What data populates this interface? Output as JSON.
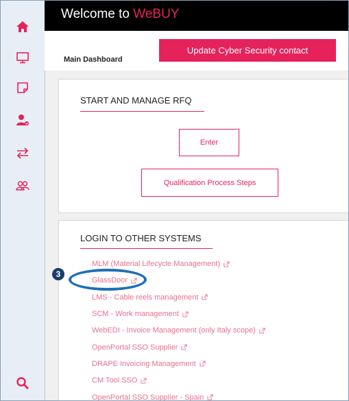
{
  "header": {
    "title_prefix": "Welcome to ",
    "title_brand": "WeBUY"
  },
  "dashboard": {
    "label": "Main Dashboard",
    "update_button": "Update Cyber Security contact"
  },
  "rfq_card": {
    "title": "START AND MANAGE RFQ",
    "enter_button": "Enter",
    "qualification_button": "Qualification Process Steps"
  },
  "login_card": {
    "title": "LOGIN TO OTHER SYSTEMS",
    "links": [
      "MLM (Material Lifecycle Management)",
      "GlassDoor",
      "LMS - Cable reels management",
      "SCM - Work management",
      "WebEDI - Invoice Management (only Italy scope)",
      "OpenPortal SSO Supplier",
      "DRAPE Invoicing Management",
      "CM Tool SSO",
      "OpenPortal SSO Supplier - Spain"
    ]
  },
  "annotation": {
    "step_number": "3"
  },
  "sidebar": {
    "icons": [
      "home-icon",
      "monitor-icon",
      "note-icon",
      "user-check-icon",
      "swap-arrows-icon",
      "users-icon",
      "search-icon"
    ]
  },
  "colors": {
    "brand": "#e5225c",
    "link": "#e8708f",
    "sidebar_icon": "#e5225c",
    "highlight": "#1f6fb5"
  }
}
